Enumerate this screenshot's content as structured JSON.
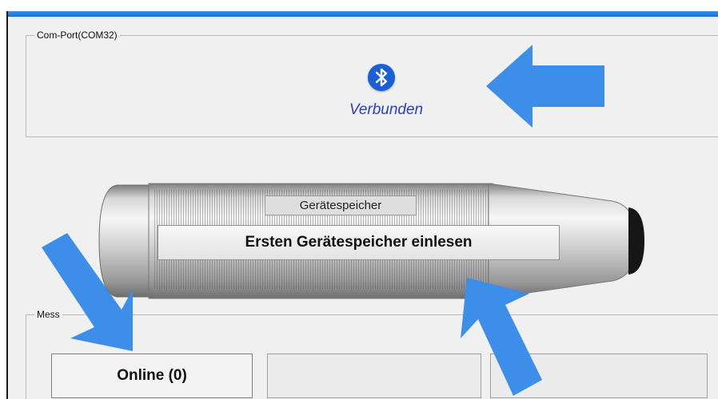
{
  "com_port": {
    "legend": "Com-Port(COM32)",
    "icon": "bluetooth-icon",
    "status": "Verbunden"
  },
  "device": {
    "memory_label": "Gerätespeicher",
    "read_button": "Ersten Gerätespeicher einlesen"
  },
  "measurement": {
    "legend": "Mess",
    "tabs": [
      {
        "label": "Online (0)"
      },
      {
        "label": ""
      },
      {
        "label": ""
      }
    ]
  },
  "colors": {
    "accent_arrow": "#3d8ee8",
    "bluetooth_blue": "#1a5fd6",
    "status_text": "#2a3fc8"
  }
}
